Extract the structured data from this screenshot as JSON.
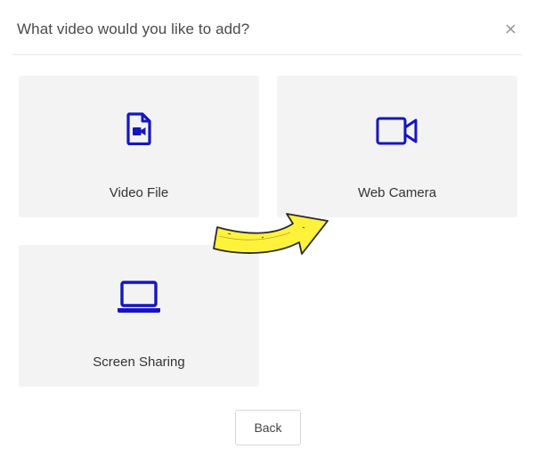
{
  "dialog": {
    "title": "What video would you like to add?",
    "close_icon": "close-icon"
  },
  "options": [
    {
      "label": "Video File",
      "icon": "video-file-icon"
    },
    {
      "label": "Web Camera",
      "icon": "video-camera-icon"
    },
    {
      "label": "Screen Sharing",
      "icon": "laptop-icon"
    }
  ],
  "footer": {
    "back_label": "Back"
  },
  "colors": {
    "accent": "#1515c4",
    "card_background": "#f3f3f3",
    "annotation_arrow": "#fff23a"
  }
}
